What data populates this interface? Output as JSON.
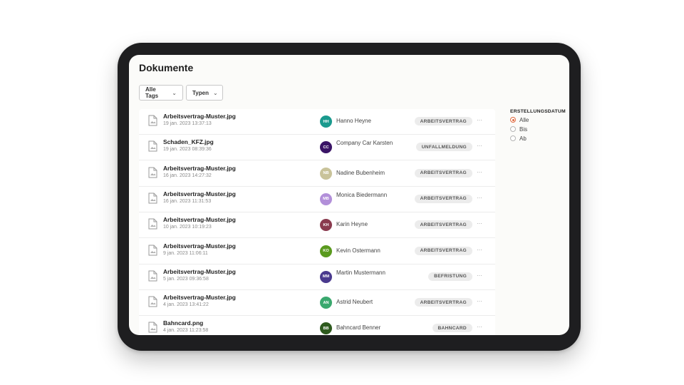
{
  "page_title": "Dokumente",
  "filters": {
    "tags_label": "Alle Tags",
    "types_label": "Typen"
  },
  "documents": [
    {
      "name": "Arbeitsvertrag-Muster.jpg",
      "date": "19 jan. 2023 13:37:13",
      "initials": "HH",
      "avatar_color": "#1a9a8e",
      "person": "Hanno Heyne",
      "tag": "ARBEITSVERTRAG"
    },
    {
      "name": "Schaden_KFZ.jpg",
      "date": "19 jan. 2023 08:39:36",
      "initials": "CC",
      "avatar_color": "#3a1466",
      "person": "Company Car Karsten",
      "tag": "UNFALLMELDUNG"
    },
    {
      "name": "Arbeitsvertrag-Muster.jpg",
      "date": "16 jan. 2023 14:27:32",
      "initials": "NB",
      "avatar_color": "#c9c39a",
      "person": "Nadine Bubenheim",
      "tag": "ARBEITSVERTRAG"
    },
    {
      "name": "Arbeitsvertrag-Muster.jpg",
      "date": "16 jan. 2023 11:31:53",
      "initials": "MB",
      "avatar_color": "#b28fd9",
      "person": "Monica Biedermann",
      "tag": "ARBEITSVERTRAG"
    },
    {
      "name": "Arbeitsvertrag-Muster.jpg",
      "date": "10 jan. 2023 10:19:23",
      "initials": "KH",
      "avatar_color": "#8a3a4e",
      "person": "Karin Heyne",
      "tag": "ARBEITSVERTRAG"
    },
    {
      "name": "Arbeitsvertrag-Muster.jpg",
      "date": "9 jan. 2023 11:06:11",
      "initials": "KO",
      "avatar_color": "#5a9a1e",
      "person": "Kevin Ostermann",
      "tag": "ARBEITSVERTRAG"
    },
    {
      "name": "Arbeitsvertrag-Muster.jpg",
      "date": "5 jan. 2023 09:36:58",
      "initials": "MM",
      "avatar_color": "#4a3a8e",
      "person": "Martin Mustermann",
      "tag": "BEFRISTUNG"
    },
    {
      "name": "Arbeitsvertrag-Muster.jpg",
      "date": "4 jan. 2023 13:41:22",
      "initials": "AN",
      "avatar_color": "#3aa86e",
      "person": "Astrid Neubert",
      "tag": "ARBEITSVERTRAG"
    },
    {
      "name": "Bahncard.png",
      "date": "4 jan. 2023 11:23:58",
      "initials": "BB",
      "avatar_color": "#2e5a1e",
      "person": "Bahncard Benner",
      "tag": "BAHNCARD"
    }
  ],
  "more_label": "···",
  "date_filter": {
    "title": "ERSTELLUNGSDATUM",
    "options": [
      "Alle",
      "Bis",
      "Ab"
    ],
    "selected": "Alle"
  },
  "colors": {
    "accent": "#e0683e",
    "device_frame": "#1e1e20"
  }
}
